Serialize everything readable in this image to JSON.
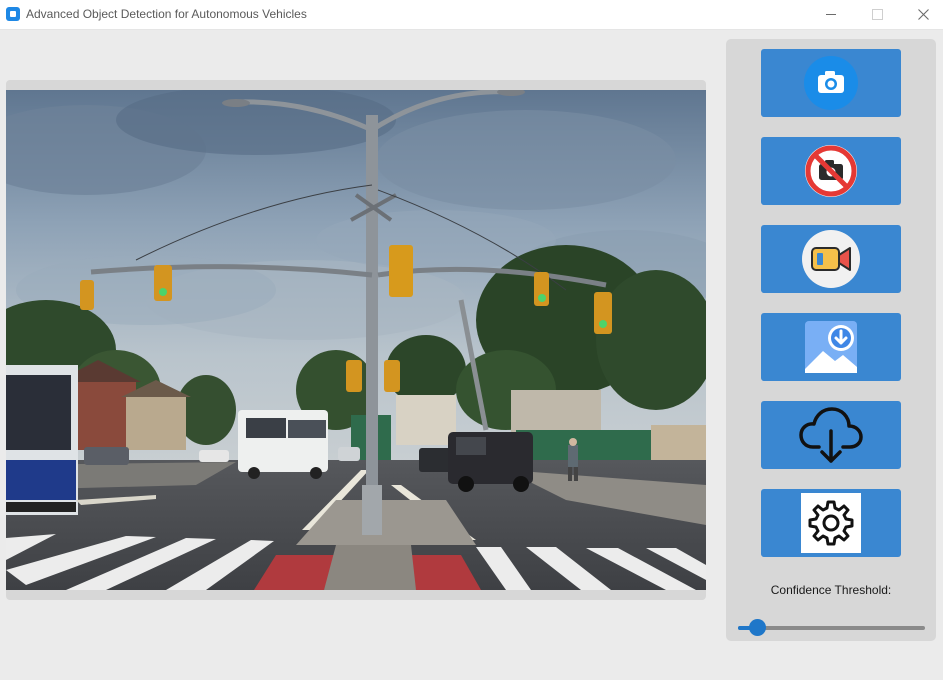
{
  "window": {
    "title": "Advanced Object Detection for Autonomous Vehicles"
  },
  "toolbar": {
    "buttons": [
      {
        "name": "open-camera-button",
        "icon": "camera-icon"
      },
      {
        "name": "stop-camera-button",
        "icon": "camera-off-icon"
      },
      {
        "name": "open-video-button",
        "icon": "video-camera-icon"
      },
      {
        "name": "load-image-button",
        "icon": "image-download-icon"
      },
      {
        "name": "save-result-button",
        "icon": "cloud-download-icon"
      },
      {
        "name": "settings-button",
        "icon": "gear-icon"
      }
    ]
  },
  "confidence": {
    "label": "Confidence Threshold:",
    "value": 0.1
  },
  "colors": {
    "accent": "#3a87d1",
    "slider": "#1f77c9",
    "panel": "#d7d7d7",
    "background": "#ebebeb"
  }
}
